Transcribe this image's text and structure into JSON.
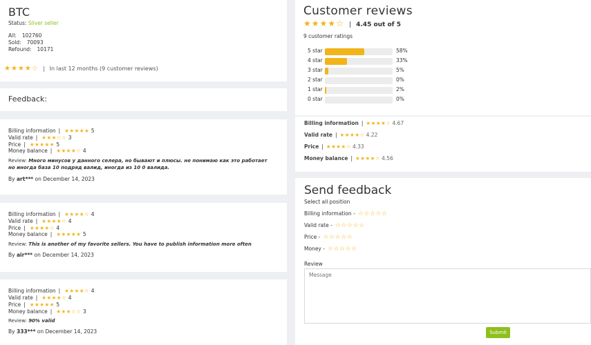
{
  "seller": {
    "name": "BTC",
    "status_label": "Status:",
    "status_value": "Silver seller",
    "stats": [
      {
        "label": "All:",
        "value": "102760"
      },
      {
        "label": "Sold:",
        "value": "70093"
      },
      {
        "label": "Refound:",
        "value": "10171"
      }
    ],
    "rating_stars": "★★★★☆",
    "rating_text": "In last 12 months (9 customer reviews)"
  },
  "feedback_title": "Feedback:",
  "reviews": [
    {
      "lines": [
        {
          "label": "Billing information",
          "stars": "★★★★★",
          "value": "5"
        },
        {
          "label": "Valid rate",
          "stars": "★★★☆☆",
          "value": "3"
        },
        {
          "label": "Price",
          "stars": "★★★★★",
          "value": "5"
        },
        {
          "label": "Money balance",
          "stars": "★★★★☆",
          "value": "4"
        }
      ],
      "review_label": "Review:",
      "review_text": "Много минусов у данного селера, но бывают и плюсы. не понимаю как это работает но иногда база 10 подряд валид, иногда из 10 0 валида.",
      "by_prefix": "By",
      "author": "art***",
      "date": "on December 14, 2023"
    },
    {
      "lines": [
        {
          "label": "Billing information",
          "stars": "★★★★☆",
          "value": "4"
        },
        {
          "label": "Valid rate",
          "stars": "★★★★☆",
          "value": "4"
        },
        {
          "label": "Price",
          "stars": "★★★★☆",
          "value": "4"
        },
        {
          "label": "Money balance",
          "stars": "★★★★★",
          "value": "5"
        }
      ],
      "review_label": "Review:",
      "review_text": "This is another of my favorite sellers. You have to publish information more often",
      "by_prefix": "By",
      "author": "air***",
      "date": "on December 14, 2023"
    },
    {
      "lines": [
        {
          "label": "Billing information",
          "stars": "★★★★☆",
          "value": "4"
        },
        {
          "label": "Valid rate",
          "stars": "★★★★☆",
          "value": "4"
        },
        {
          "label": "Price",
          "stars": "★★★★★",
          "value": "5"
        },
        {
          "label": "Money balance",
          "stars": "★★★☆☆",
          "value": "3"
        }
      ],
      "review_label": "Review:",
      "review_text": "90% valid",
      "by_prefix": "By",
      "author": "333***",
      "date": "on December 14, 2023"
    }
  ],
  "customer_reviews": {
    "title": "Customer reviews",
    "avg_stars": "★★★★☆",
    "avg_text": "4.45 out of 5",
    "count_text": "9 customer ratings",
    "distribution": [
      {
        "label": "5 star",
        "percent": 58,
        "text": "58%"
      },
      {
        "label": "4 star",
        "percent": 33,
        "text": "33%"
      },
      {
        "label": "3 star",
        "percent": 5,
        "text": "5%"
      },
      {
        "label": "2 star",
        "percent": 0,
        "text": "0%"
      },
      {
        "label": "1 star",
        "percent": 2,
        "text": "2%"
      },
      {
        "label": "0 star",
        "percent": 0,
        "text": "0%"
      }
    ]
  },
  "breakdown": [
    {
      "label": "Billing information",
      "stars": "★★★★☆",
      "value": "4.67"
    },
    {
      "label": "Valid rate",
      "stars": "★★★★☆",
      "value": "4.22"
    },
    {
      "label": "Price",
      "stars": "★★★★☆",
      "value": "4.33"
    },
    {
      "label": "Money balance",
      "stars": "★★★★☆",
      "value": "4.56"
    }
  ],
  "send_feedback": {
    "title": "Send feedback",
    "subtitle": "Select all position",
    "rows": [
      {
        "label": "Billing information",
        "stars": "☆☆☆☆☆"
      },
      {
        "label": "Valid rate",
        "stars": "☆☆☆☆☆"
      },
      {
        "label": "Price",
        "stars": "☆☆☆☆☆"
      },
      {
        "label": "Money",
        "stars": "☆☆☆☆☆"
      }
    ],
    "review_label": "Review",
    "review_placeholder": "Message",
    "submit_label": "Submit"
  },
  "colors": {
    "star": "#f2b41b",
    "accent_green": "#8fbf1c"
  }
}
